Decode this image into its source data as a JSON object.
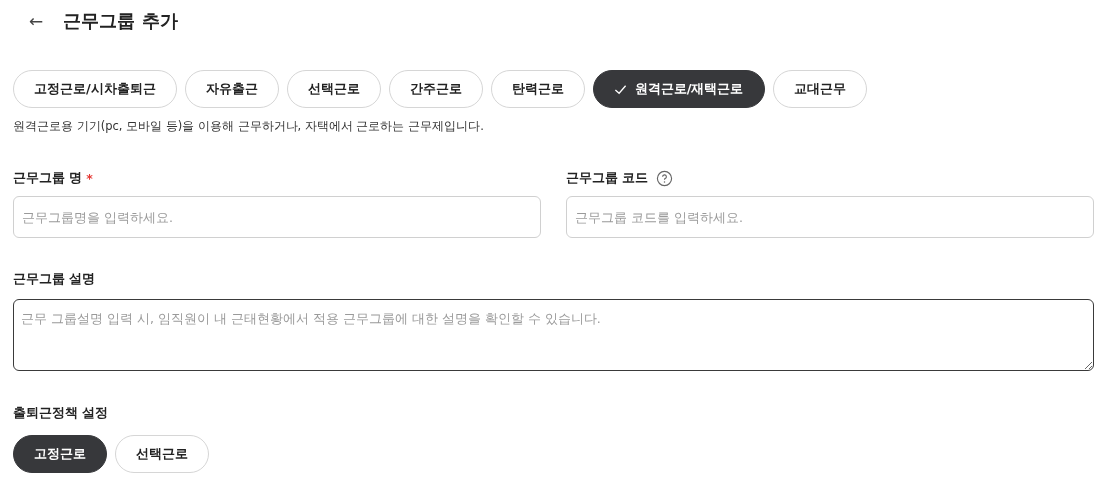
{
  "header": {
    "back": "←",
    "title": "근무그룹 추가"
  },
  "work_types": [
    {
      "label": "고정근로/시차출퇴근",
      "selected": false
    },
    {
      "label": "자유출근",
      "selected": false
    },
    {
      "label": "선택근로",
      "selected": false
    },
    {
      "label": "간주근로",
      "selected": false
    },
    {
      "label": "탄력근로",
      "selected": false
    },
    {
      "label": "원격근로/재택근로",
      "selected": true
    },
    {
      "label": "교대근무",
      "selected": false
    }
  ],
  "work_type_description": "원격근로용 기기(pc, 모바일 등)을 이용해 근무하거나, 자택에서 근로하는 근무제입니다.",
  "fields": [
    {
      "label": "근무그룹 명",
      "required_mark": "*",
      "placeholder": "근무그룹명을 입력하세요."
    },
    {
      "label": "근무그룹 코드",
      "help": true,
      "placeholder": "근무그룹 코드를 입력하세요."
    }
  ],
  "description_field": {
    "label": "근무그룹 설명",
    "placeholder": "근무 그룹설명 입력 시, 임직원이 내 근태현황에서 적용 근무그룹에 대한 설명을 확인할 수 있습니다."
  },
  "policy": {
    "label": "출퇴근정책 설정",
    "options": [
      {
        "label": "고정근로",
        "selected": true
      },
      {
        "label": "선택근로",
        "selected": false
      }
    ]
  }
}
